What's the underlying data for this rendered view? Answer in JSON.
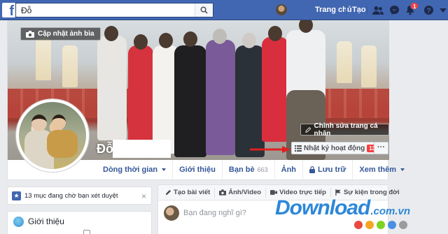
{
  "topbar": {
    "search_value": "Đỗ",
    "links": [
      "Trang chủ",
      "Tạo"
    ],
    "notification_count": "1"
  },
  "cover": {
    "update_cover_label": "Cập nhật ảnh bìa",
    "profile_name": "Đỗ",
    "edit_profile_label": "Chỉnh sửa trang cá nhân",
    "activity_log_label": "Nhật ký hoạt động",
    "activity_log_count": "13",
    "more_label": "···"
  },
  "tabs": [
    {
      "label": "Dòng thời gian",
      "dropdown": true
    },
    {
      "label": "Giới thiệu"
    },
    {
      "label": "Bạn bè",
      "count": "663"
    },
    {
      "label": "Ảnh"
    },
    {
      "label": "Lưu trữ"
    },
    {
      "label": "Xem thêm",
      "dropdown": true
    }
  ],
  "pending": {
    "text": "13 mục đang chờ bạn xét duyệt",
    "close": "×"
  },
  "intro": {
    "title": "Giới thiệu"
  },
  "composer": {
    "tabs": [
      "Tạo bài viết",
      "Ảnh/Video",
      "Video trực tiếp",
      "Sự kiện trong đời"
    ],
    "placeholder": "Bạn đang nghĩ gì?"
  },
  "watermark": {
    "main": "Download",
    "sub": ".com.vn"
  },
  "colors": {
    "topbar": "#4267b2",
    "link": "#365899",
    "badge": "#fa3e3e",
    "watermark_dots": [
      "#e8493f",
      "#f5a623",
      "#7ed321",
      "#4a90e2",
      "#9b9b9b"
    ]
  }
}
